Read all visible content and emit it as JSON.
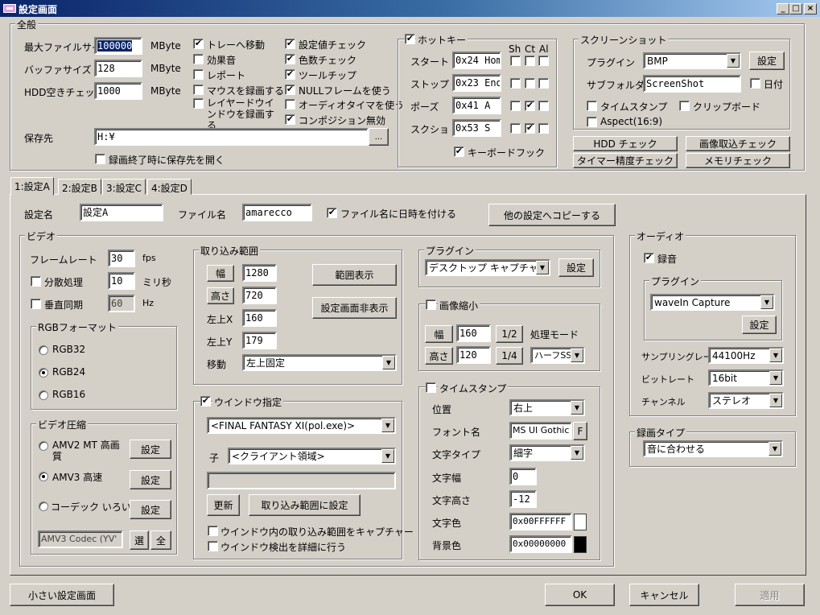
{
  "window": {
    "title": "設定画面",
    "minimize": "_",
    "maximize": "□",
    "close": "×"
  },
  "general": {
    "group_label": "全般",
    "max_file_size_label": "最大ファイルサイズ",
    "max_file_size": "100000",
    "buffer_size_label": "バッファサイズ",
    "buffer_size": "128",
    "hdd_check_label": "HDD空きチェック",
    "hdd_check": "1000",
    "unit": "MByte",
    "options_col1": [
      {
        "label": "トレーへ移動",
        "checked": true
      },
      {
        "label": "効果音",
        "checked": false
      },
      {
        "label": "レポート",
        "checked": false
      },
      {
        "label": "マウスを録画する",
        "checked": false
      },
      {
        "label": "レイヤードウインドウを録画する",
        "checked": false
      }
    ],
    "options_col2": [
      {
        "label": "設定値チェック",
        "checked": true
      },
      {
        "label": "色数チェック",
        "checked": true
      },
      {
        "label": "ツールチップ",
        "checked": true
      },
      {
        "label": "NULLフレームを使う",
        "checked": true
      },
      {
        "label": "オーディオタイマを使う",
        "checked": false
      },
      {
        "label": "コンポジション無効",
        "checked": true
      }
    ],
    "save_dest_label": "保存先",
    "save_dest": "H:¥",
    "browse_label": "...",
    "open_after_label": "録画終了時に保存先を開く",
    "open_after_checked": false
  },
  "hotkey": {
    "group_label": "ホットキー",
    "enabled": true,
    "col_headers": [
      "Sh",
      "Ct",
      "Al"
    ],
    "rows": [
      {
        "label": "スタート",
        "value": "0x24 Hom",
        "sh": false,
        "ct": false,
        "al": false
      },
      {
        "label": "ストップ",
        "value": "0x23 End",
        "sh": false,
        "ct": false,
        "al": false
      },
      {
        "label": "ポーズ",
        "value": "0x41 A",
        "sh": false,
        "ct": true,
        "al": false
      },
      {
        "label": "スクショ",
        "value": "0x53 S",
        "sh": false,
        "ct": true,
        "al": false
      }
    ],
    "keyboard_hook_label": "キーボードフック",
    "keyboard_hook": true
  },
  "screenshot": {
    "group_label": "スクリーンショット",
    "plugin_label": "プラグイン",
    "plugin_value": "BMP",
    "settings_label": "設定",
    "subfolder_label": "サブフォルダ",
    "subfolder_value": "ScreenShot",
    "date_label": "日付",
    "date_checked": false,
    "timestamp_label": "タイムスタンプ",
    "timestamp_checked": false,
    "clipboard_label": "クリップボード",
    "clipboard_checked": false,
    "aspect_label": "Aspect(16:9)",
    "aspect_checked": false
  },
  "checks": {
    "hdd_check": "HDD チェック",
    "image_capture_check": "画像取込チェック",
    "timer_check": "タイマー精度チェック",
    "memory_check": "メモリチェック"
  },
  "tabs": [
    {
      "label": "1:設定A",
      "active": true
    },
    {
      "label": "2:設定B",
      "active": false
    },
    {
      "label": "3:設定C",
      "active": false
    },
    {
      "label": "4:設定D",
      "active": false
    }
  ],
  "profile": {
    "name_label": "設定名",
    "name_value": "設定A",
    "file_label": "ファイル名",
    "file_value": "amarecco",
    "add_datetime_label": "ファイル名に日時を付ける",
    "add_datetime": true,
    "copy_button": "他の設定へコピーする"
  },
  "video": {
    "group_label": "ビデオ",
    "framerate_label": "フレームレート",
    "framerate": "30",
    "framerate_unit": "fps",
    "distributed_label": "分散処理",
    "distributed_checked": false,
    "distributed_value": "10",
    "distributed_unit": "ミリ秒",
    "vsync_label": "垂直同期",
    "vsync_checked": false,
    "vsync_value": "60",
    "vsync_unit": "Hz",
    "rgb_group_label": "RGBフォーマット",
    "rgb_options": [
      {
        "label": "RGB32",
        "selected": false
      },
      {
        "label": "RGB24",
        "selected": true
      },
      {
        "label": "RGB16",
        "selected": false
      }
    ],
    "compress_group_label": "ビデオ圧縮",
    "compress_options": [
      {
        "label": "AMV2 MT 高画質",
        "selected": false
      },
      {
        "label": "AMV3 高速",
        "selected": true
      },
      {
        "label": "コーデック いろいろ",
        "selected": false
      }
    ],
    "compress_settings": "設定",
    "codec_value": "AMV3 Codec (YV'",
    "select_button": "選",
    "all_button": "全"
  },
  "capture_range": {
    "group_label": "取り込み範囲",
    "width_button": "幅",
    "width": "1280",
    "height_button": "高さ",
    "height": "720",
    "x_label": "左上X",
    "x": "160",
    "y_label": "左上Y",
    "y": "179",
    "move_label": "移動",
    "move_value": "左上固定",
    "show_range": "範囲表示",
    "hide_settings": "設定画面非表示"
  },
  "window_spec": {
    "group_label": "ウインドウ指定",
    "enabled": true,
    "window_value": "<FINAL FANTASY XI(pol.exe)>",
    "child_label": "子",
    "child_value": "<クライアント領域>",
    "info_value": "",
    "refresh": "更新",
    "set_range": "取り込み範囲に設定",
    "capture_in_window_label": "ウインドウ内の取り込み範囲をキャプチャー",
    "capture_in_window": false,
    "detailed_detect_label": "ウインドウ検出を詳細に行う",
    "detailed_detect": false
  },
  "plugin": {
    "group_label": "プラグイン",
    "value": "デスクトップ キャプチャー",
    "settings": "設定"
  },
  "shrink": {
    "group_label": "画像縮小",
    "enabled": false,
    "width_button": "幅",
    "width": "160",
    "half": "1/2",
    "mode_label": "処理モード",
    "height_button": "高さ",
    "height": "120",
    "quarter": "1/4",
    "mode_value": "ハーフSSE"
  },
  "timestamp": {
    "group_label": "タイムスタンプ",
    "enabled": false,
    "position_label": "位置",
    "position_value": "右上",
    "font_label": "フォント名",
    "font_value": "MS UI Gothic",
    "font_button": "F",
    "style_label": "文字タイプ",
    "style_value": "細字",
    "char_width_label": "文字幅",
    "char_width": "0",
    "char_height_label": "文字高さ",
    "char_height": "-12",
    "fg_label": "文字色",
    "fg_value": "0x00FFFFFF",
    "fg_color": "#ffffff",
    "bg_label": "背景色",
    "bg_value": "0x00000000",
    "bg_color": "#000000"
  },
  "audio": {
    "group_label": "オーディオ",
    "record_label": "録音",
    "record": true,
    "plugin_group_label": "プラグイン",
    "plugin_value": "waveIn Capture",
    "plugin_settings": "設定",
    "sample_rate_label": "サンプリングレート",
    "sample_rate": "44100Hz",
    "bitrate_label": "ビットレート",
    "bitrate": "16bit",
    "channel_label": "チャンネル",
    "channel": "ステレオ"
  },
  "record_type": {
    "group_label": "録画タイプ",
    "value": "音に合わせる"
  },
  "footer": {
    "small_settings": "小さい設定画面",
    "ok": "OK",
    "cancel": "キャンセル",
    "apply": "適用"
  }
}
